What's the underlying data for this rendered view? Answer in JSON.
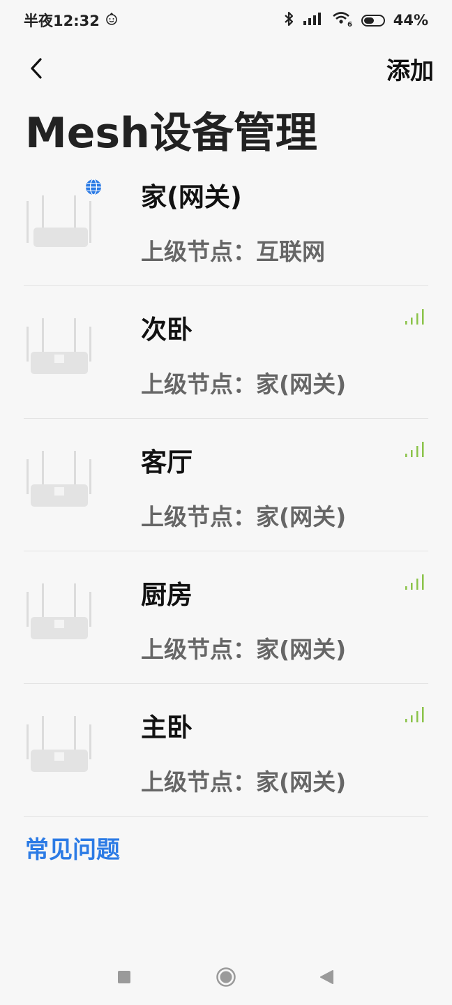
{
  "status_bar": {
    "time": "半夜12:32",
    "battery_level": "44%",
    "icons": [
      "smiley-icon",
      "bluetooth-icon",
      "cellular-signal-icon",
      "wifi-icon",
      "battery-icon"
    ]
  },
  "nav": {
    "back_icon": "chevron-left-icon",
    "add_label": "添加"
  },
  "page_title": "Mesh设备管理",
  "parent_prefix": "上级节点：",
  "devices": [
    {
      "name": "家(网关)",
      "parent": "互联网",
      "gateway": true
    },
    {
      "name": "次卧",
      "parent": "家(网关)",
      "signal": "strong"
    },
    {
      "name": "客厅",
      "parent": "家(网关)",
      "signal": "strong"
    },
    {
      "name": "厨房",
      "parent": "家(网关)",
      "signal": "strong"
    },
    {
      "name": "主卧",
      "parent": "家(网关)",
      "signal": "strong"
    }
  ],
  "faq_label": "常见问题",
  "colors": {
    "accent": "#2c7be5",
    "signal": "#8bc34a",
    "muted_text": "#666666"
  },
  "system_nav": [
    "recents-square-icon",
    "home-circle-icon",
    "back-triangle-icon"
  ]
}
